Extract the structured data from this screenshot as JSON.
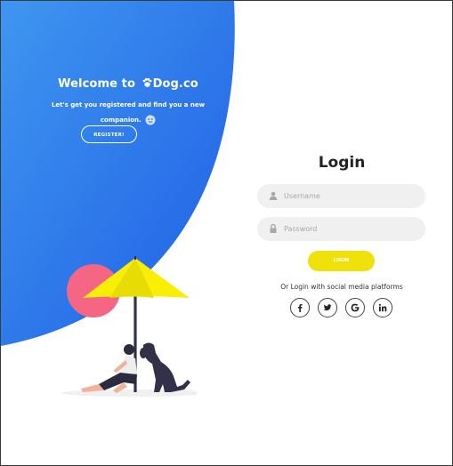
{
  "hero": {
    "welcome_prefix": "Welcome to ",
    "brand": "Dog.co",
    "subtitle": "Let's get you registered and find you a new companion.",
    "register_label": "REGISTER!"
  },
  "login": {
    "title": "Login",
    "username_placeholder": "Username",
    "password_placeholder": "Password",
    "login_label": "LOGIN",
    "social_text": "Or Login with social media platforms"
  },
  "social": [
    "facebook-icon",
    "twitter-icon",
    "google-icon",
    "linkedin-icon"
  ],
  "colors": {
    "blue_gradient_start": "#1e5ee5",
    "blue_gradient_end": "#3f96f0",
    "accent_yellow": "#efe20a",
    "field_bg": "#f0f0f0",
    "pink_circle": "#f46683"
  }
}
